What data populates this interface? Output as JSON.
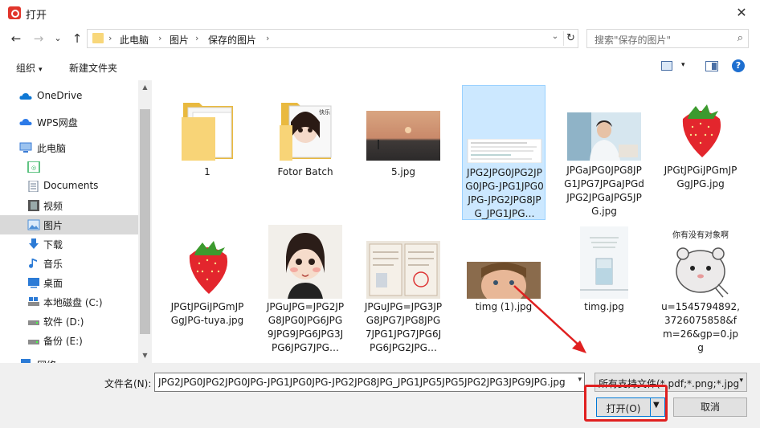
{
  "window": {
    "title": "打开",
    "close": "✕"
  },
  "nav": {
    "back": "←",
    "forward": "→",
    "recent": "⌄",
    "up": "↑",
    "breadcrumb": [
      "此电脑",
      "图片",
      "保存的图片"
    ],
    "sep": "›",
    "dropdown": "⌄",
    "refresh": "↻",
    "search_placeholder": "搜索\"保存的图片\"",
    "search_icon": "⌕"
  },
  "toolbar": {
    "organize": "组织",
    "new_folder": "新建文件夹",
    "caret": "▾",
    "help": "?"
  },
  "sidebar": {
    "items": [
      {
        "label": "OneDrive",
        "icon": "cloud-icon",
        "color": "#0f78d4"
      },
      {
        "label": "WPS网盘",
        "icon": "cloud-icon",
        "color": "#2d7be8"
      },
      {
        "label": "此电脑",
        "icon": "computer-icon",
        "color": "#3a7bd5"
      },
      {
        "label": "",
        "icon": "wechat-folder-icon",
        "color": "#2bb15a"
      },
      {
        "label": "Documents",
        "icon": "document-icon",
        "color": "#6a7b90"
      },
      {
        "label": "视频",
        "icon": "video-icon",
        "color": "#555555"
      },
      {
        "label": "图片",
        "icon": "pictures-icon",
        "color": "#4d8fd6",
        "selected": true
      },
      {
        "label": "下载",
        "icon": "download-icon",
        "color": "#2c7bd6"
      },
      {
        "label": "音乐",
        "icon": "music-icon",
        "color": "#2c7bd6"
      },
      {
        "label": "桌面",
        "icon": "desktop-icon",
        "color": "#2c7bd6"
      },
      {
        "label": "本地磁盘 (C:)",
        "icon": "drive-c-icon",
        "color": "#606060"
      },
      {
        "label": "软件 (D:)",
        "icon": "drive-icon",
        "color": "#606060"
      },
      {
        "label": "备份 (E:)",
        "icon": "drive-icon",
        "color": "#606060"
      },
      {
        "label": "网络",
        "icon": "network-icon",
        "color": "#2c7bd6"
      }
    ]
  },
  "files": [
    {
      "label": "1",
      "kind": "folder"
    },
    {
      "label": "Fotor Batch",
      "kind": "folder-photo"
    },
    {
      "label": "5.jpg",
      "kind": "sunset"
    },
    {
      "label": "JPG2JPG0JPG2JPG0JPG-JPG1JPG0JPG-JPG2JPG8JPG_JPG1JPG…",
      "kind": "doc",
      "selected": true
    },
    {
      "label": "JPGaJPG0JPG8JPG1JPG7JPGaJPGdJPG2JPGaJPG5JPG.jpg",
      "kind": "boy"
    },
    {
      "label": "JPGtJPGiJPGmJPGgJPG.jpg",
      "kind": "strawberry"
    },
    {
      "label": "JPGtJPGiJPGmJPGgJPG-tuya.jpg",
      "kind": "strawberry"
    },
    {
      "label": "JPGuJPG=JPG2JPG8JPG0JPG6JPG9JPG9JPG6JPG3JPG6JPG7JPG…",
      "kind": "girl"
    },
    {
      "label": "JPGuJPG=JPG3JPG8JPG7JPG8JPG7JPG1JPG7JPG6JPG6JPG2JPG…",
      "kind": "cert"
    },
    {
      "label": "timg (1).jpg",
      "kind": "face"
    },
    {
      "label": "timg.jpg",
      "kind": "glass"
    },
    {
      "label": "u=1545794892,3726075858&fm=26&gp=0.jpg",
      "kind": "hamster"
    }
  ],
  "thumb_text": {
    "hamster_caption": "你有没有对象啊",
    "folder_sticker": "快乐"
  },
  "bottom": {
    "filename_label": "文件名(N):",
    "filename_value": "JPG2JPG0JPG2JPG0JPG-JPG1JPG0JPG-JPG2JPG8JPG_JPG1JPG5JPG5JPG2JPG3JPG9JPG.jpg",
    "filetype_value": "所有支持文件(*.pdf;*.png;*.jpg",
    "dd": "▾",
    "open_label": "打开(O)",
    "open_caret": "▼",
    "cancel_label": "取消"
  },
  "colors": {
    "accent": "#0078d7",
    "selection": "#cce8ff",
    "annotation_red": "#e02020"
  }
}
